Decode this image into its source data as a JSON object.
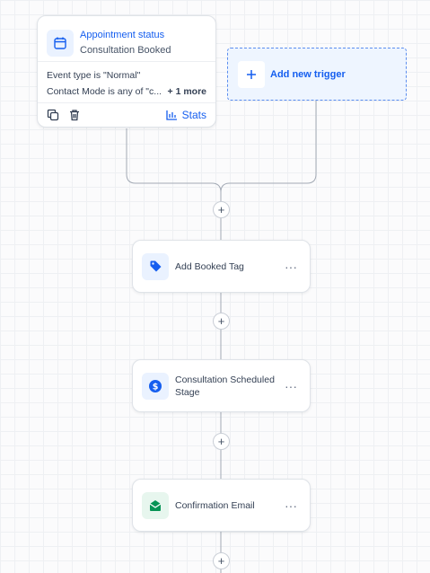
{
  "trigger": {
    "title": "Appointment status",
    "subtitle": "Consultation Booked",
    "condition_1": "Event type is \"Normal\"",
    "condition_2": "Contact Mode is any of \"c...",
    "more": "+ 1 more",
    "stats_label": "Stats",
    "icon": "calendar-icon"
  },
  "add_trigger": {
    "label": "Add new trigger",
    "icon": "plus-icon"
  },
  "actions": [
    {
      "label": "Add Booked Tag",
      "icon": "tag-icon",
      "icon_color": "#155eef"
    },
    {
      "label": "Consultation Scheduled Stage",
      "icon": "dollar-icon",
      "icon_color": "#155eef"
    },
    {
      "label": "Confirmation Email",
      "icon": "email-icon",
      "icon_color": "#079455"
    }
  ],
  "plus_symbol": "+",
  "more_symbol": "···",
  "colors": {
    "accent": "#155eef",
    "email": "#079455",
    "line": "#a3aab5"
  }
}
